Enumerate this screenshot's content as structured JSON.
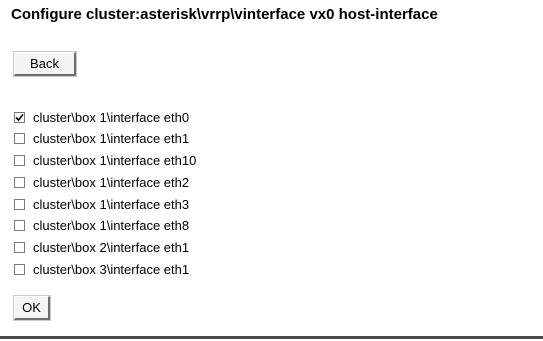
{
  "page": {
    "title": "Configure cluster:asterisk\\vrrp\\vinterface vx0 host-interface"
  },
  "buttons": {
    "back_label": "Back",
    "ok_label": "OK"
  },
  "interfaces": [
    {
      "label": "cluster\\box 1\\interface eth0",
      "checked": true
    },
    {
      "label": "cluster\\box 1\\interface eth1",
      "checked": false
    },
    {
      "label": "cluster\\box 1\\interface eth10",
      "checked": false
    },
    {
      "label": "cluster\\box 1\\interface eth2",
      "checked": false
    },
    {
      "label": "cluster\\box 1\\interface eth3",
      "checked": false
    },
    {
      "label": "cluster\\box 1\\interface eth8",
      "checked": false
    },
    {
      "label": "cluster\\box 2\\interface eth1",
      "checked": false
    },
    {
      "label": "cluster\\box 3\\interface eth1",
      "checked": false
    }
  ]
}
